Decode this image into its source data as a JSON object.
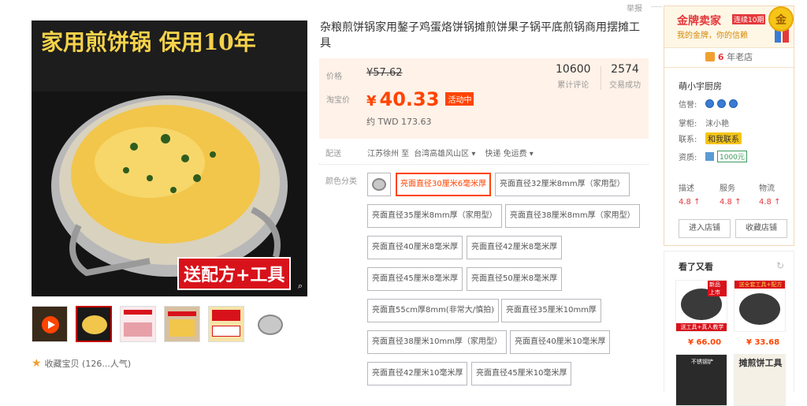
{
  "report_label": "举报",
  "product": {
    "title": "杂粮煎饼锅家用鏊子鸡蛋烙饼锅摊煎饼果子锅平底煎锅商用摆摊工具",
    "main_image_text": {
      "headline": "家用煎饼锅 保用10年",
      "promo": "送配方+工具"
    },
    "favorite": "收藏宝贝 (126...人气)"
  },
  "price": {
    "label": "价格",
    "original": "¥57.62",
    "taobao_label": "淘宝价",
    "yen": "¥",
    "sale": "40.33",
    "badge": "活动中",
    "twd": "约 TWD 173.63",
    "reviews_num": "10600",
    "reviews_label": "累计评论",
    "sales_num": "2574",
    "sales_label": "交易成功"
  },
  "shipping": {
    "label": "配送",
    "from": "江苏徐州 至",
    "to": "台湾高雄风山区",
    "method": "快递 免运费"
  },
  "colors": {
    "label": "颜色分类",
    "options": [
      "亮面直径30厘米6毫米厚",
      "亮面直径32厘米8mm厚（家用型）",
      "亮面直径35厘米8mm厚（家用型）",
      "亮面直径38厘米8mm厚（家用型）",
      "亮面直径40厘米8毫米厚",
      "亮面直径42厘米8毫米厚",
      "亮面直径45厘米8毫米厚",
      "亮面直径50厘米8毫米厚",
      "亮面直55cm厚8mm(非常大/慎拍)",
      "亮面直径35厘米10mm厚",
      "亮面直径38厘米10mm厚（家用型）",
      "亮面直径40厘米10毫米厚",
      "亮面直径42厘米10毫米厚",
      "亮面直径45厘米10毫米厚"
    ]
  },
  "shop": {
    "gold_title": "金牌卖家",
    "gold_tag": "连续10期",
    "gold_sub": "我的金牌，你的信赖",
    "medal": "金",
    "years_num": "6",
    "years_label": "年老店",
    "name": "萌小宇厨房",
    "credit_label": "信誉:",
    "keeper_label": "掌柜:",
    "keeper": "沫小艳",
    "contact_label": "联系:",
    "contact": "和我联系",
    "qual_label": "资质:",
    "qual": "1000元",
    "scores": [
      {
        "label": "描述",
        "value": "4.8 ↑"
      },
      {
        "label": "服务",
        "value": "4.8 ↑"
      },
      {
        "label": "物流",
        "value": "4.8 ↑"
      }
    ],
    "enter_btn": "进入店铺",
    "fav_btn": "收藏店铺"
  },
  "also_viewed": {
    "title": "看了又看",
    "items": [
      {
        "price": "¥ 66.00",
        "tag": "送工具+真人教学",
        "top": "新品上市"
      },
      {
        "price": "¥ 33.68",
        "tag": "送全套工具+配方",
        "top": ""
      },
      {
        "price": "",
        "tag": "不锈钢铲",
        "top": ""
      },
      {
        "price": "",
        "tag": "摊煎饼工具",
        "top": ""
      }
    ]
  },
  "colors_palette": {
    "accent": "#ff4400",
    "price_bg": "#fff2e8"
  }
}
